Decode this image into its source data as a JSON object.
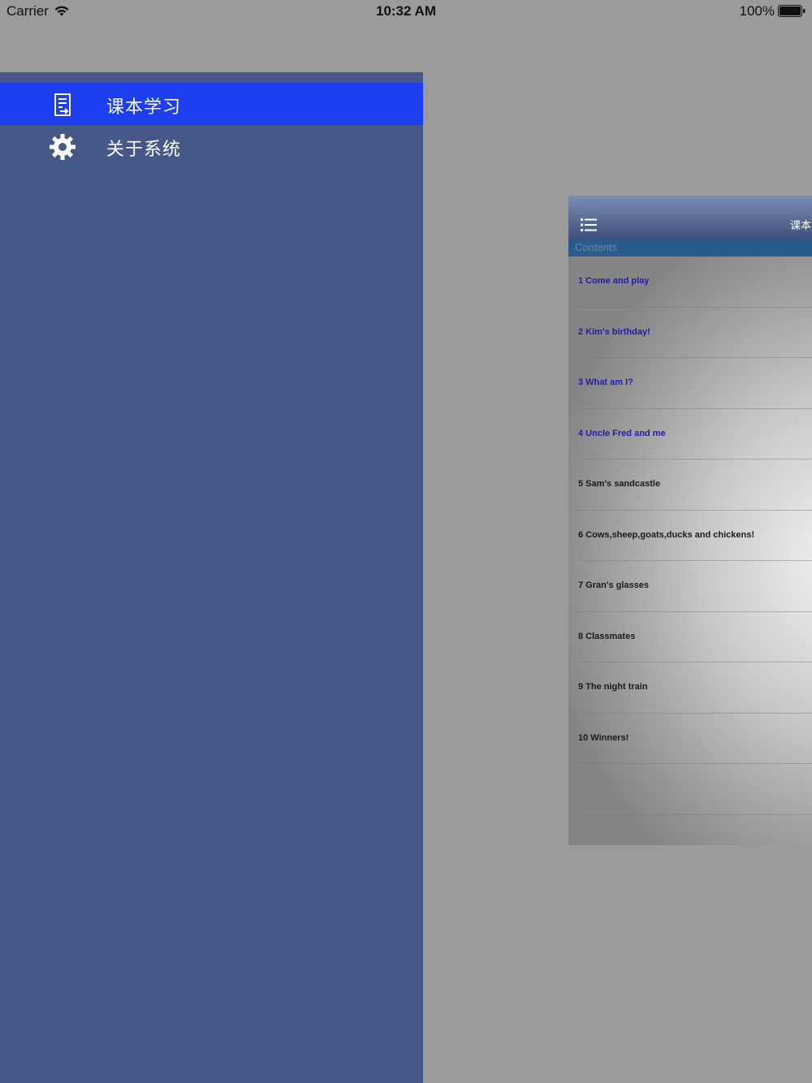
{
  "status_bar": {
    "carrier": "Carrier",
    "time": "10:32 AM",
    "battery": "100%"
  },
  "side_menu": {
    "items": [
      {
        "label": "课本学习",
        "icon": "textbook-icon",
        "selected": true
      },
      {
        "label": "关于系统",
        "icon": "gear-icon",
        "selected": false
      }
    ]
  },
  "content": {
    "header_title": "课本",
    "section_title": "Contents",
    "lessons": [
      {
        "title": "1 Come and play"
      },
      {
        "title": "2 Kim's birthday!"
      },
      {
        "title": "3 What am I?"
      },
      {
        "title": "4 Uncle Fred and me"
      },
      {
        "title": "5 Sam's sandcastle"
      },
      {
        "title": "6 Cows,sheep,goats,ducks and chickens!"
      },
      {
        "title": "7 Gran's glasses"
      },
      {
        "title": "8 Classmates"
      },
      {
        "title": "9 The night train"
      },
      {
        "title": "10 Winners!"
      }
    ]
  },
  "colors": {
    "background": "#9b9b9b",
    "menu_background": "#455888",
    "menu_selected": "#1e3ff0",
    "link_text": "#1e1ea8"
  }
}
